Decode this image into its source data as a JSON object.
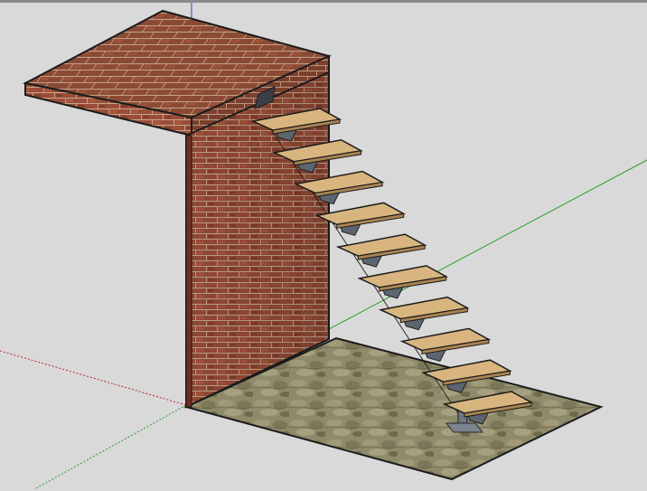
{
  "app": {
    "kind": "3d-modeling-viewport"
  },
  "viewport": {
    "background_color": "#d9d9d9",
    "frame_color": "#8a8a8a",
    "axes": {
      "red_color": "#c02a2a",
      "green_color": "#2aa02a",
      "blue_color": "#3a3ad0"
    }
  },
  "model": {
    "name_hint": "brick-wall-landing-with-floating-stair",
    "materials": {
      "brick_top": "#8a4a34",
      "brick_front_wall": "#9a4d38",
      "brick_side_face": "#7c3f2d",
      "mortar": "#c9a58a",
      "stone_floor": "#8f8a6a",
      "tread_wood": "#d8b57f",
      "tread_edge": "#a98352",
      "steel": "#5d6570"
    },
    "stair": {
      "tread_count": 10
    }
  }
}
